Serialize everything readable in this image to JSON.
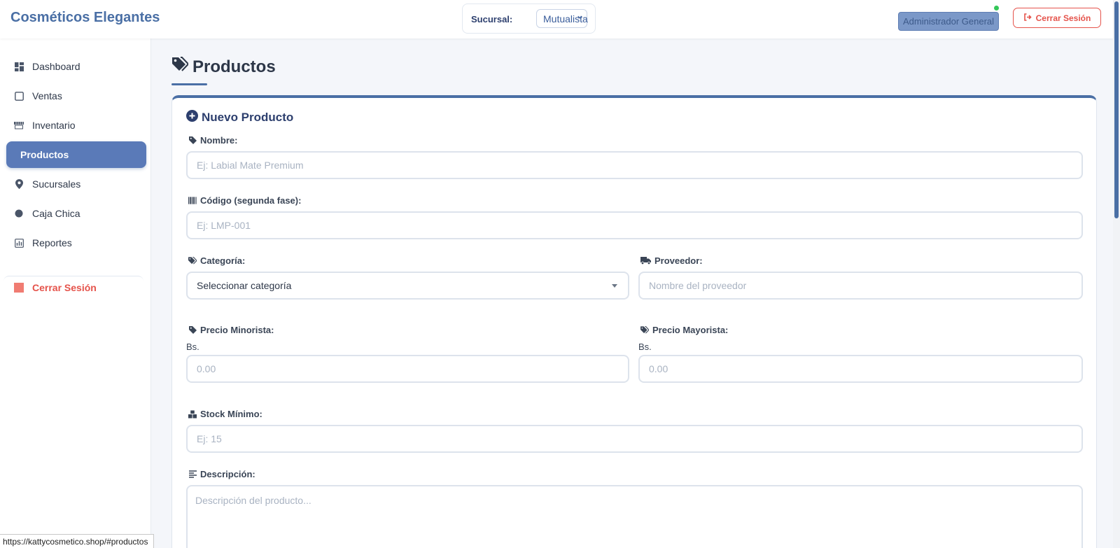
{
  "header": {
    "brand": "Cosméticos Elegantes",
    "branch_label": "Sucursal:",
    "branch_value": "Mutualista",
    "role": "Administrador General",
    "logout_label": "Cerrar Sesión"
  },
  "sidebar": {
    "items": [
      {
        "label": "Dashboard",
        "icon": "dashboard-icon"
      },
      {
        "label": "Ventas",
        "icon": "checkbox-icon"
      },
      {
        "label": "Inventario",
        "icon": "store-icon"
      },
      {
        "label": "Productos",
        "icon": "",
        "active": true
      },
      {
        "label": "Sucursales",
        "icon": "location-pin-icon"
      },
      {
        "label": "Caja Chica",
        "icon": "circle-icon"
      },
      {
        "label": "Reportes",
        "icon": "chart-icon"
      }
    ],
    "logout_label": "Cerrar Sesión"
  },
  "page": {
    "title": "Productos"
  },
  "form": {
    "title": "Nuevo Producto",
    "nombre": {
      "label": "Nombre:",
      "placeholder": "Ej: Labial Mate Premium"
    },
    "codigo": {
      "label": "Código (segunda fase):",
      "placeholder": "Ej: LMP-001"
    },
    "categoria": {
      "label": "Categoría:",
      "value": "Seleccionar categoría"
    },
    "proveedor": {
      "label": "Proveedor:",
      "placeholder": "Nombre del proveedor"
    },
    "precio_minorista": {
      "label": "Precio Minorista:",
      "prefix": "Bs.",
      "placeholder": "0.00"
    },
    "precio_mayorista": {
      "label": "Precio Mayorista:",
      "prefix": "Bs.",
      "placeholder": "0.00"
    },
    "stock_minimo": {
      "label": "Stock Mínimo:",
      "placeholder": "Ej: 15"
    },
    "descripcion": {
      "label": "Descripción:",
      "placeholder": "Descripción del producto..."
    }
  },
  "status_bar": {
    "url": "https://kattycosmetico.shop/#productos"
  },
  "colors": {
    "accent": "#4a6fa5",
    "danger": "#e5534b",
    "online": "#34c759"
  }
}
